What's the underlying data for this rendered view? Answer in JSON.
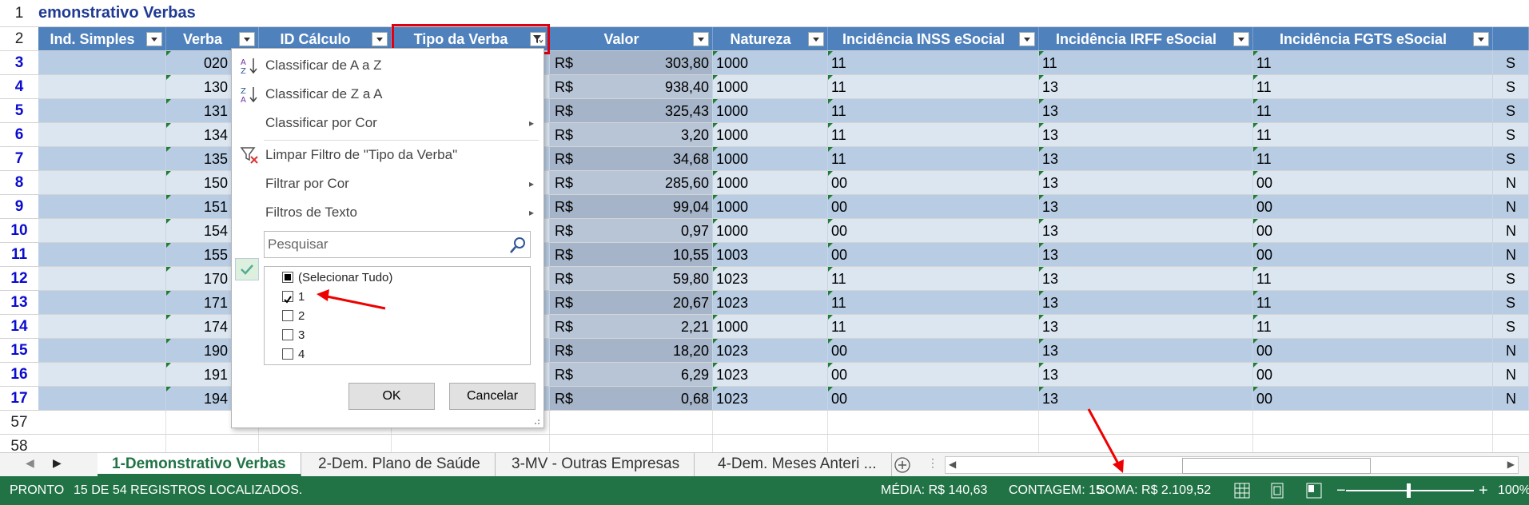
{
  "sheet_title": "emonstrativo Verbas",
  "title_row_number": "1",
  "header_row_number": "2",
  "columns": [
    "Ind. Simples",
    "Verba",
    "ID Cálculo",
    "Tipo da Verba",
    "Valor",
    "Natureza",
    "Incidência INSS eSocial",
    "Incidência IRFF eSocial",
    "Incidência FGTS eSocial"
  ],
  "rows": [
    {
      "n": "3",
      "verba": "020",
      "cur": "R$",
      "valor": "303,80",
      "nat": "1000",
      "inss": "11",
      "irrf": "11",
      "fgts": "11",
      "last": "S"
    },
    {
      "n": "4",
      "verba": "130",
      "cur": "R$",
      "valor": "938,40",
      "nat": "1000",
      "inss": "11",
      "irrf": "13",
      "fgts": "11",
      "last": "S"
    },
    {
      "n": "5",
      "verba": "131",
      "cur": "R$",
      "valor": "325,43",
      "nat": "1000",
      "inss": "11",
      "irrf": "13",
      "fgts": "11",
      "last": "S"
    },
    {
      "n": "6",
      "verba": "134",
      "cur": "R$",
      "valor": "3,20",
      "nat": "1000",
      "inss": "11",
      "irrf": "13",
      "fgts": "11",
      "last": "S"
    },
    {
      "n": "7",
      "verba": "135",
      "cur": "R$",
      "valor": "34,68",
      "nat": "1000",
      "inss": "11",
      "irrf": "13",
      "fgts": "11",
      "last": "S"
    },
    {
      "n": "8",
      "verba": "150",
      "cur": "R$",
      "valor": "285,60",
      "nat": "1000",
      "inss": "00",
      "irrf": "13",
      "fgts": "00",
      "last": "N"
    },
    {
      "n": "9",
      "verba": "151",
      "cur": "R$",
      "valor": "99,04",
      "nat": "1000",
      "inss": "00",
      "irrf": "13",
      "fgts": "00",
      "last": "N"
    },
    {
      "n": "10",
      "verba": "154",
      "cur": "R$",
      "valor": "0,97",
      "nat": "1000",
      "inss": "00",
      "irrf": "13",
      "fgts": "00",
      "last": "N"
    },
    {
      "n": "11",
      "verba": "155",
      "cur": "R$",
      "valor": "10,55",
      "nat": "1003",
      "inss": "00",
      "irrf": "13",
      "fgts": "00",
      "last": "N"
    },
    {
      "n": "12",
      "verba": "170",
      "cur": "R$",
      "valor": "59,80",
      "nat": "1023",
      "inss": "11",
      "irrf": "13",
      "fgts": "11",
      "last": "S"
    },
    {
      "n": "13",
      "verba": "171",
      "cur": "R$",
      "valor": "20,67",
      "nat": "1023",
      "inss": "11",
      "irrf": "13",
      "fgts": "11",
      "last": "S"
    },
    {
      "n": "14",
      "verba": "174",
      "cur": "R$",
      "valor": "2,21",
      "nat": "1000",
      "inss": "11",
      "irrf": "13",
      "fgts": "11",
      "last": "S"
    },
    {
      "n": "15",
      "verba": "190",
      "cur": "R$",
      "valor": "18,20",
      "nat": "1023",
      "inss": "00",
      "irrf": "13",
      "fgts": "00",
      "last": "N"
    },
    {
      "n": "16",
      "verba": "191",
      "cur": "R$",
      "valor": "6,29",
      "nat": "1023",
      "inss": "00",
      "irrf": "13",
      "fgts": "00",
      "last": "N"
    },
    {
      "n": "17",
      "verba": "194",
      "cur": "R$",
      "valor": "0,68",
      "nat": "1023",
      "inss": "00",
      "irrf": "13",
      "fgts": "00",
      "last": "N"
    }
  ],
  "extra_rows": [
    "57",
    "58"
  ],
  "filter_menu": {
    "sort_az": "Classificar de A a Z",
    "sort_za": "Classificar de Z a A",
    "sort_color": "Classificar por Cor",
    "clear_filter": "Limpar Filtro de \"Tipo da Verba\"",
    "filter_color": "Filtrar por Cor",
    "text_filters": "Filtros de Texto",
    "search_placeholder": "Pesquisar",
    "items": [
      {
        "label": "(Selecionar Tudo)",
        "state": "partial"
      },
      {
        "label": "1",
        "state": "checked"
      },
      {
        "label": "2",
        "state": "unchecked"
      },
      {
        "label": "3",
        "state": "unchecked"
      },
      {
        "label": "4",
        "state": "unchecked"
      }
    ],
    "ok": "OK",
    "cancel": "Cancelar"
  },
  "sheet_tabs": [
    "1-Demonstrativo Verbas",
    "2-Dem. Plano de Saúde",
    "3-MV - Outras Empresas",
    "4-Dem. Meses Anteri ..."
  ],
  "active_tab": 0,
  "status": {
    "mode": "PRONTO",
    "records": "15 DE 54 REGISTROS LOCALIZADOS.",
    "media": "MÉDIA:  R$ 140,63",
    "contagem": "CONTAGEM: 15",
    "soma": "SOMA:  R$ 2.109,52",
    "zoom": "100%"
  },
  "colors": {
    "header": "#4f81bd",
    "band_a": "#b8cce4",
    "band_b": "#dce6f1",
    "status": "#217346",
    "highlight": "#e0000f"
  }
}
